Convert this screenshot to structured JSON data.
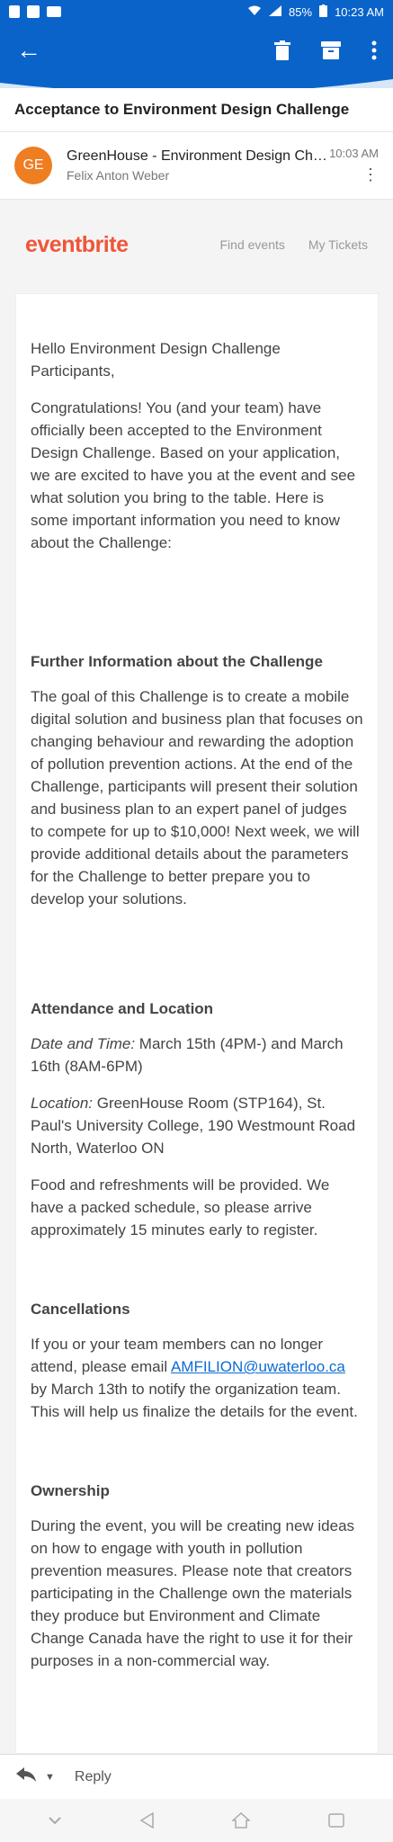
{
  "status_bar": {
    "battery": "85%",
    "time": "10:23 AM"
  },
  "toolbar": {
    "back": "←"
  },
  "email": {
    "subject": "Acceptance to Environment Design Challenge",
    "avatar_initials": "GE",
    "from": "GreenHouse - Environment Design Challenge",
    "to": "Felix Anton Weber",
    "time": "10:03 AM"
  },
  "eventbrite": {
    "logo": "eventbrite",
    "nav": {
      "find_events": "Find events",
      "my_tickets": "My Tickets"
    }
  },
  "body": {
    "greeting": "Hello Environment Design Challenge Participants,",
    "intro": "Congratulations! You (and your team) have officially been accepted to the Environment Design Challenge. Based on your application, we are excited to have you at the event and see what solution you bring to the table. Here is some important information you need to know about the Challenge:",
    "further_heading": "Further Information about the Challenge",
    "further_text": "The goal of this Challenge is to create a mobile digital solution and business plan that focuses on changing behaviour and rewarding the adoption of pollution prevention actions. At the end of the Challenge, participants will present their solution and business plan to an expert panel of judges to compete for up to $10,000! Next week, we will provide additional details about the parameters for the Challenge to better prepare you to develop your solutions.",
    "attendance_heading": "Attendance and Location",
    "date_label": "Date and Time:",
    "date_value": " March 15th (4PM-) and March 16th (8AM-6PM)",
    "location_label": "Location:",
    "location_value": " GreenHouse Room (STP164), St. Paul's University College, 190 Westmount Road North, Waterloo ON",
    "food_text": "Food and refreshments will be provided. We have a packed schedule, so please arrive approximately 15 minutes early to register.",
    "cancellations_heading": "Cancellations",
    "cancel_before": "If you or your team members can no longer attend, please email ",
    "cancel_email": "AMFILION@uwaterloo.ca",
    "cancel_after": " by March 13th to notify the organization team. This will help us finalize the details for the event.",
    "ownership_heading": "Ownership",
    "ownership_text": "During the event, you will be creating new ideas on how to engage with youth in pollution prevention measures. Please note that creators participating in the Challenge own the materials they produce but Environment and Climate Change Canada have the right to use it for their purposes in a non-commercial way."
  },
  "reply_bar": {
    "label": "Reply"
  },
  "colors": {
    "app_blue": "#0a63c9",
    "eventbrite_orange": "#f05537",
    "avatar_orange": "#ef7d22",
    "link": "#0c6bd3"
  }
}
